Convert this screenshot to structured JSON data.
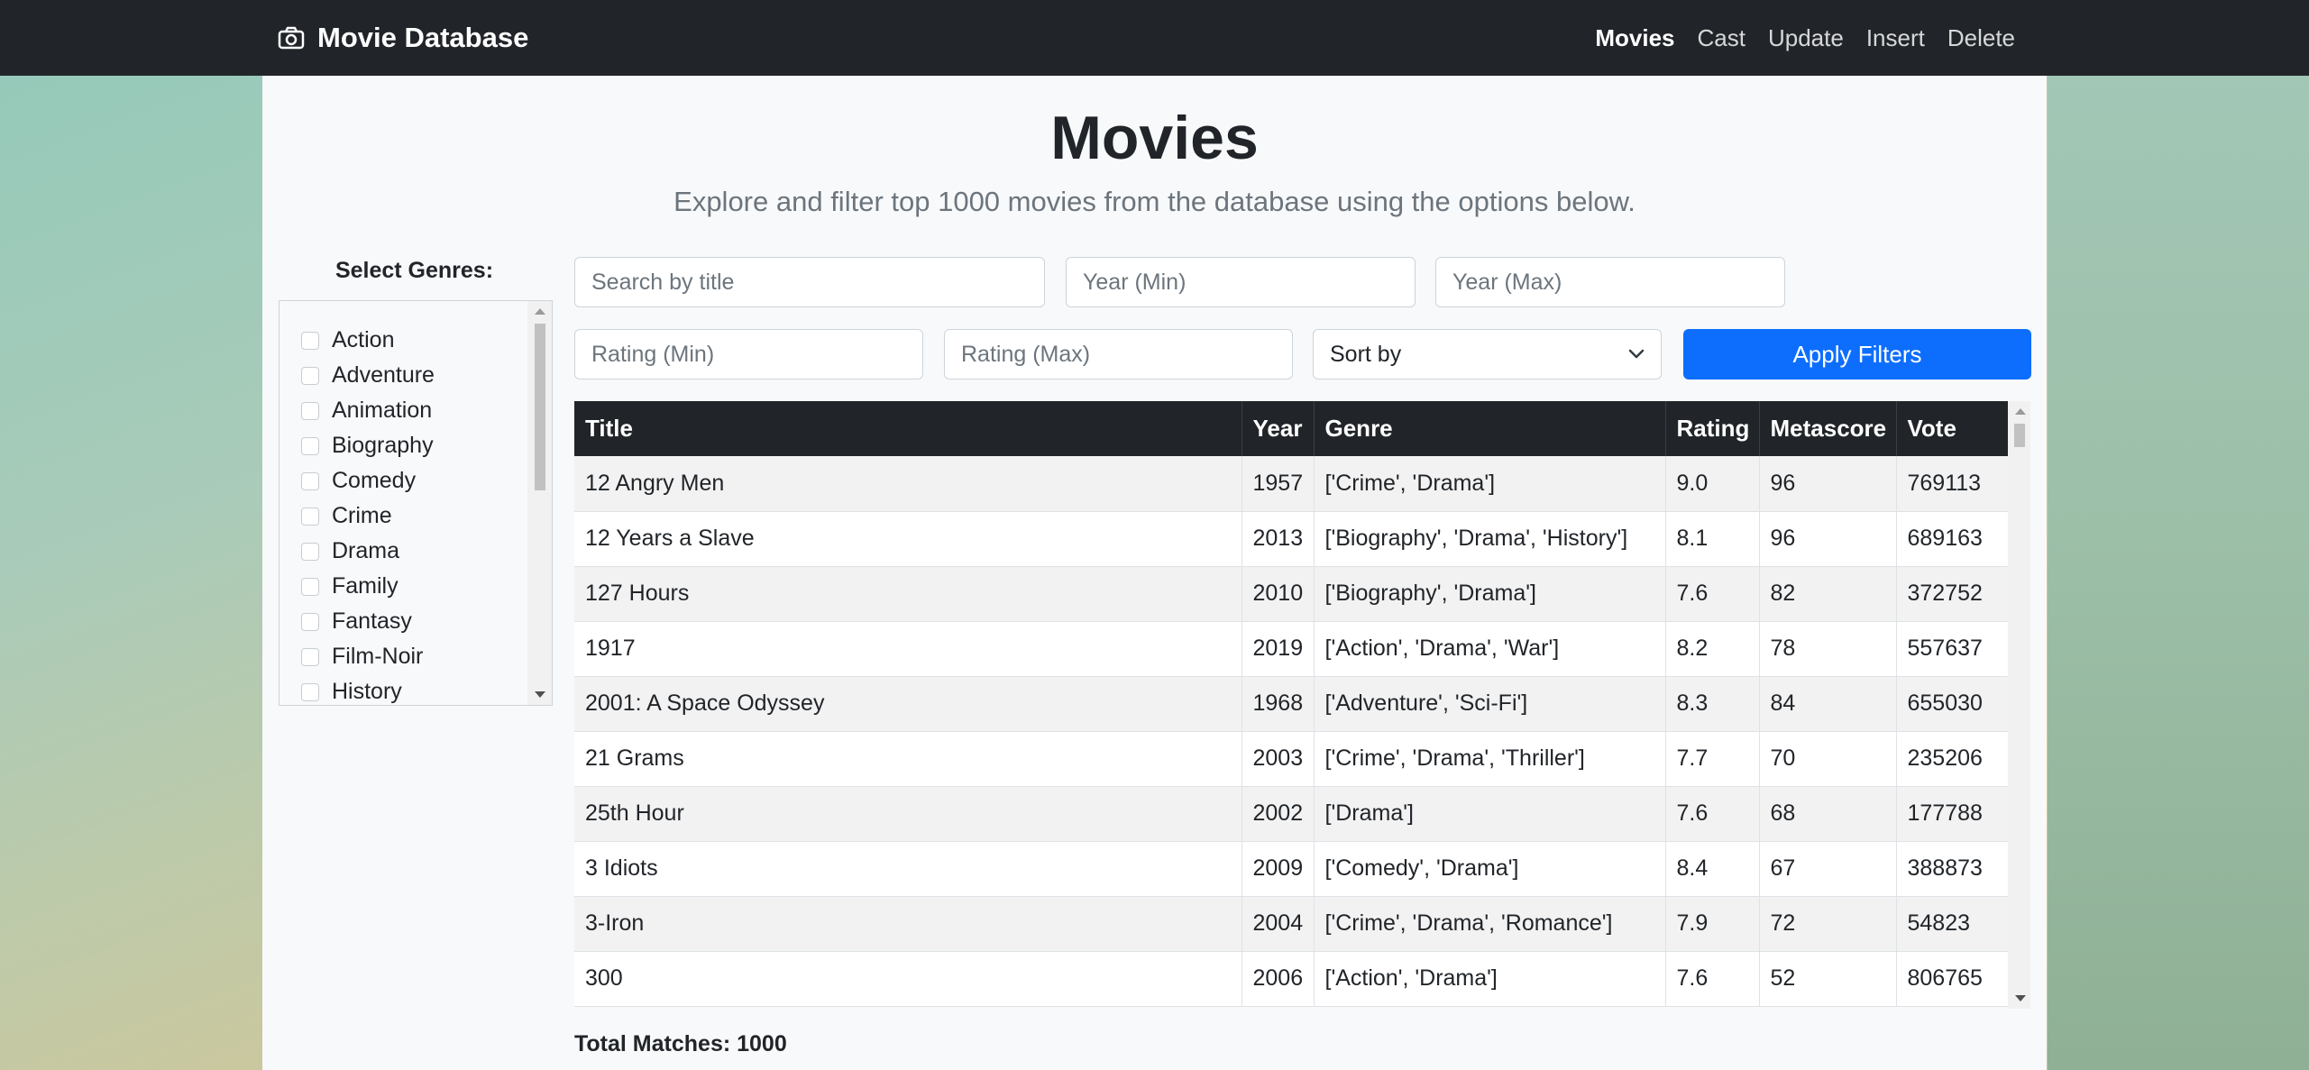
{
  "nav": {
    "brand": "Movie Database",
    "links": [
      {
        "label": "Movies",
        "active": true
      },
      {
        "label": "Cast"
      },
      {
        "label": "Update"
      },
      {
        "label": "Insert"
      },
      {
        "label": "Delete"
      }
    ]
  },
  "header": {
    "title": "Movies",
    "subtitle": "Explore and filter top 1000 movies from the database using the options below."
  },
  "genres": {
    "label": "Select Genres:",
    "items": [
      "Action",
      "Adventure",
      "Animation",
      "Biography",
      "Comedy",
      "Crime",
      "Drama",
      "Family",
      "Fantasy",
      "Film-Noir",
      "History"
    ]
  },
  "filters": {
    "search_placeholder": "Search by title",
    "year_min_placeholder": "Year (Min)",
    "year_max_placeholder": "Year (Max)",
    "rating_min_placeholder": "Rating (Min)",
    "rating_max_placeholder": "Rating (Max)",
    "sort_label": "Sort by",
    "apply_label": "Apply Filters"
  },
  "table": {
    "columns": [
      "Title",
      "Year",
      "Genre",
      "Rating",
      "Metascore",
      "Vote"
    ],
    "rows": [
      [
        "12 Angry Men",
        "1957",
        "['Crime', 'Drama']",
        "9.0",
        "96",
        "769113"
      ],
      [
        "12 Years a Slave",
        "2013",
        "['Biography', 'Drama', 'History']",
        "8.1",
        "96",
        "689163"
      ],
      [
        "127 Hours",
        "2010",
        "['Biography', 'Drama']",
        "7.6",
        "82",
        "372752"
      ],
      [
        "1917",
        "2019",
        "['Action', 'Drama', 'War']",
        "8.2",
        "78",
        "557637"
      ],
      [
        "2001: A Space Odyssey",
        "1968",
        "['Adventure', 'Sci-Fi']",
        "8.3",
        "84",
        "655030"
      ],
      [
        "21 Grams",
        "2003",
        "['Crime', 'Drama', 'Thriller']",
        "7.7",
        "70",
        "235206"
      ],
      [
        "25th Hour",
        "2002",
        "['Drama']",
        "7.6",
        "68",
        "177788"
      ],
      [
        "3 Idiots",
        "2009",
        "['Comedy', 'Drama']",
        "8.4",
        "67",
        "388873"
      ],
      [
        "3-Iron",
        "2004",
        "['Crime', 'Drama', 'Romance']",
        "7.9",
        "72",
        "54823"
      ],
      [
        "300",
        "2006",
        "['Action', 'Drama']",
        "7.6",
        "52",
        "806765"
      ]
    ]
  },
  "total_matches": "Total Matches: 1000",
  "icons": {
    "brand": "camera-icon",
    "sort": "chevron-down-icon"
  },
  "colors": {
    "navbar": "#212529",
    "primary": "#0d6efd"
  }
}
